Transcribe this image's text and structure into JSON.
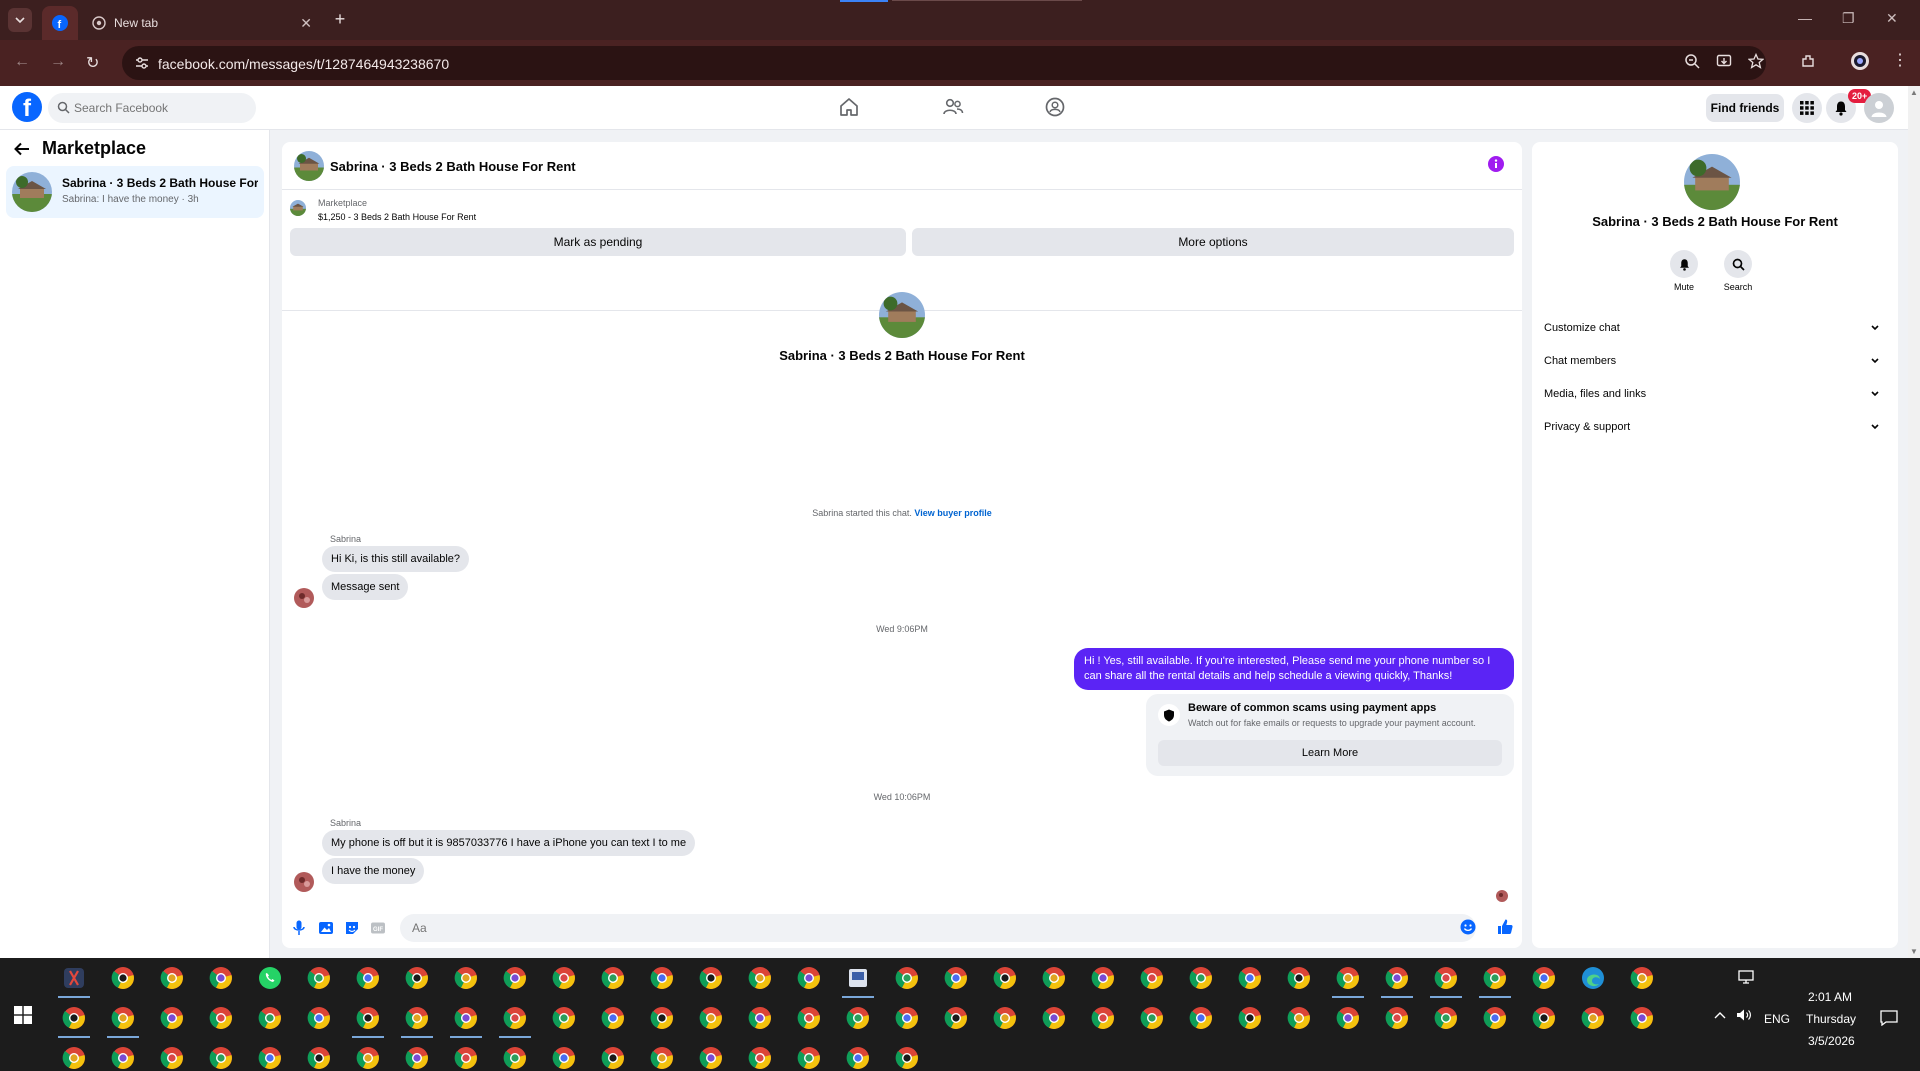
{
  "browser": {
    "tabs": [
      {
        "label": "",
        "icon": "facebook-icon",
        "active": true
      },
      {
        "label": "New tab",
        "icon": "chrome-icon",
        "active": false
      }
    ],
    "url": "facebook.com/messages/t/1287464943238670"
  },
  "header": {
    "search_placeholder": "Search Facebook",
    "find_friends": "Find friends",
    "notification_badge": "20+"
  },
  "left_panel": {
    "title": "Marketplace",
    "conversations": [
      {
        "name": "Sabrina · 3 Beds 2 Bath House For ...",
        "preview": "Sabrina: I have the money · 3h"
      }
    ]
  },
  "chat": {
    "title": "Sabrina · 3 Beds 2 Bath House For Rent",
    "listing_label": "Marketplace",
    "listing_price": "$1,250 - 3 Beds 2 Bath House For Rent",
    "mark_pending": "Mark as pending",
    "more_options": "More options",
    "profile_name": "Sabrina · 3 Beds 2 Bath House For Rent",
    "started_text": "Sabrina started this chat.",
    "view_buyer_profile": "View buyer profile",
    "messages": [
      {
        "sender": "Sabrina",
        "text": "Hi Ki, is this still available?"
      },
      {
        "text": "Message sent"
      },
      {
        "timestamp": "Wed 9:06PM"
      },
      {
        "outgoing": "Hi ! Yes, still available. If you're interested, Please send me your phone number so I can share all the rental details and help schedule a viewing quickly, Thanks!"
      },
      {
        "timestamp": "Wed 10:06PM"
      },
      {
        "sender": "Sabrina",
        "text": "My phone is off but it is 9857033776 I have a iPhone you can text I to me"
      },
      {
        "text": "I have the money"
      }
    ],
    "scam_title": "Beware of common scams using payment apps",
    "scam_sub": "Watch out for fake emails or requests to upgrade your payment account.",
    "learn_more": "Learn More",
    "composer_placeholder": "Aa"
  },
  "right_panel": {
    "name": "Sabrina · 3 Beds 2 Bath House For Rent",
    "mute": "Mute",
    "search": "Search",
    "sections": [
      "Customize chat",
      "Chat members",
      "Media, files and links",
      "Privacy & support"
    ]
  },
  "taskbar": {
    "time": "2:01 AM",
    "day": "Thursday",
    "date": "3/5/2026",
    "lang": "ENG"
  },
  "colors": {
    "brand": "#0866ff",
    "outgoing_bubble": "#5b24f5",
    "browser_frame": "#3c1f1f"
  }
}
